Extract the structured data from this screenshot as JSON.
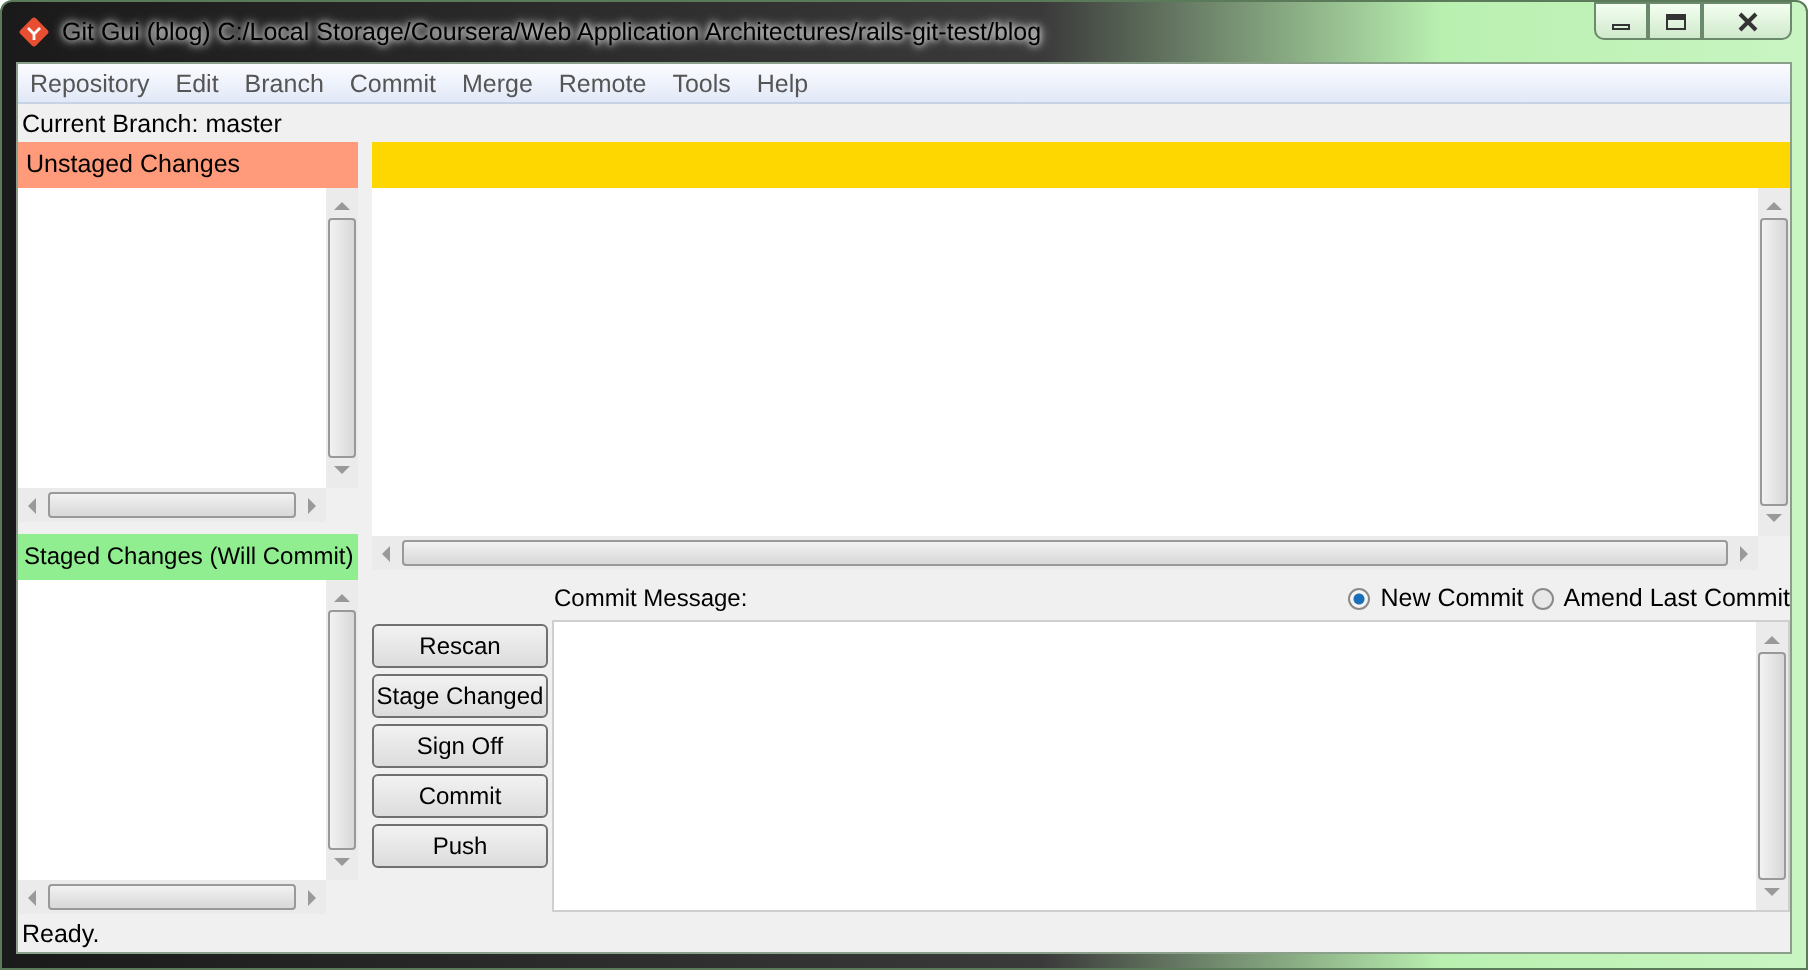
{
  "window": {
    "title": "Git Gui (blog) C:/Local Storage/Coursera/Web Application Architectures/rails-git-test/blog"
  },
  "menu": [
    "Repository",
    "Edit",
    "Branch",
    "Commit",
    "Merge",
    "Remote",
    "Tools",
    "Help"
  ],
  "current_branch": "Current Branch: master",
  "unstaged": {
    "title": "Unstaged Changes"
  },
  "staged": {
    "title": "Staged Changes (Will Commit)"
  },
  "actions": [
    "Rescan",
    "Stage Changed",
    "Sign Off",
    "Commit",
    "Push"
  ],
  "commit": {
    "label": "Commit Message:",
    "modes": [
      {
        "label": "New Commit",
        "selected": true
      },
      {
        "label": "Amend Last Commit",
        "selected": false
      }
    ]
  },
  "status_bar": "Ready."
}
